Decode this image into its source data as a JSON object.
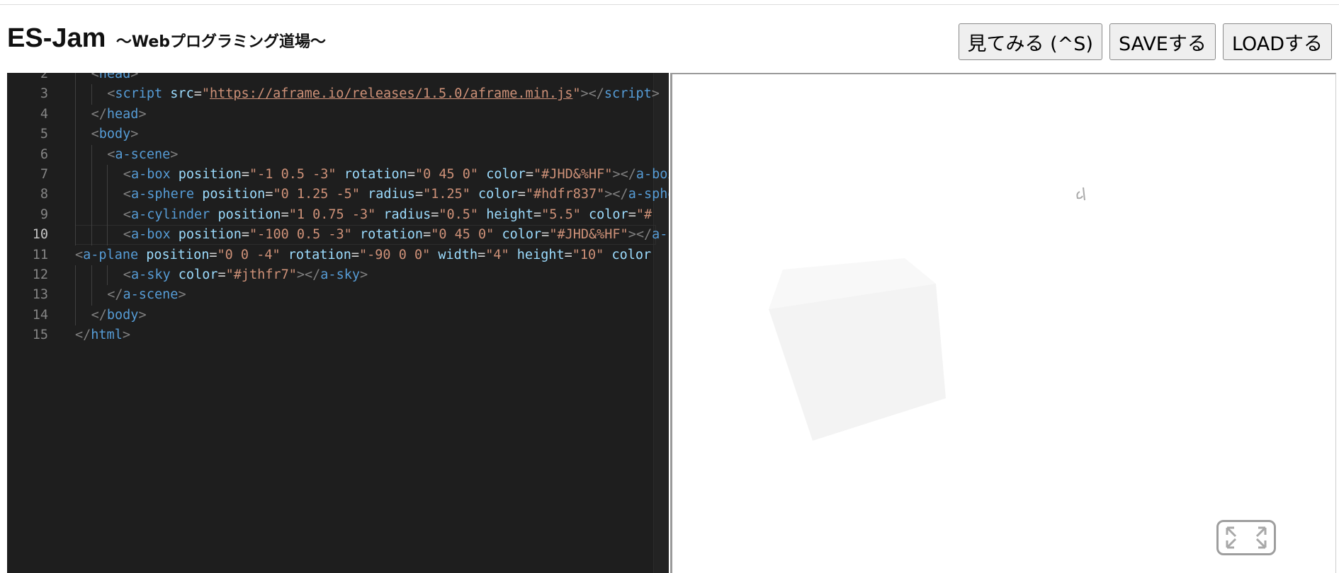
{
  "header": {
    "title": "ES-Jam",
    "subtitle": "～Webプログラミング道場～",
    "buttons": {
      "preview": "見てみる (^S)",
      "save": "SAVEする",
      "load": "LOADする"
    }
  },
  "editor": {
    "active_line": 10,
    "lines": [
      {
        "n": "2",
        "indent": 1,
        "tokens": [
          [
            "b",
            "<"
          ],
          [
            "t",
            "head"
          ],
          [
            "b",
            ">"
          ]
        ]
      },
      {
        "n": "3",
        "indent": 2,
        "tokens": [
          [
            "b",
            "<"
          ],
          [
            "t",
            "script"
          ],
          [
            "p",
            " "
          ],
          [
            "a",
            "src"
          ],
          [
            "p",
            "="
          ],
          [
            "s",
            "\""
          ],
          [
            "u",
            "https://aframe.io/releases/1.5.0/aframe.min.js"
          ],
          [
            "s",
            "\""
          ],
          [
            "b",
            "></"
          ],
          [
            "t",
            "script"
          ],
          [
            "b",
            ">"
          ]
        ]
      },
      {
        "n": "4",
        "indent": 1,
        "tokens": [
          [
            "b",
            "</"
          ],
          [
            "t",
            "head"
          ],
          [
            "b",
            ">"
          ]
        ]
      },
      {
        "n": "5",
        "indent": 1,
        "tokens": [
          [
            "b",
            "<"
          ],
          [
            "t",
            "body"
          ],
          [
            "b",
            ">"
          ]
        ]
      },
      {
        "n": "6",
        "indent": 2,
        "tokens": [
          [
            "b",
            "<"
          ],
          [
            "t",
            "a-scene"
          ],
          [
            "b",
            ">"
          ]
        ]
      },
      {
        "n": "7",
        "indent": 3,
        "tokens": [
          [
            "b",
            "<"
          ],
          [
            "t",
            "a-box"
          ],
          [
            "p",
            " "
          ],
          [
            "a",
            "position"
          ],
          [
            "p",
            "="
          ],
          [
            "s",
            "\"-1 0.5 -3\""
          ],
          [
            "p",
            " "
          ],
          [
            "a",
            "rotation"
          ],
          [
            "p",
            "="
          ],
          [
            "s",
            "\"0 45 0\""
          ],
          [
            "p",
            " "
          ],
          [
            "a",
            "color"
          ],
          [
            "p",
            "="
          ],
          [
            "s",
            "\"#JHD&%HF\""
          ],
          [
            "b",
            "></"
          ],
          [
            "t",
            "a-box"
          ],
          [
            "b",
            ">"
          ]
        ]
      },
      {
        "n": "8",
        "indent": 3,
        "tokens": [
          [
            "b",
            "<"
          ],
          [
            "t",
            "a-sphere"
          ],
          [
            "p",
            " "
          ],
          [
            "a",
            "position"
          ],
          [
            "p",
            "="
          ],
          [
            "s",
            "\"0 1.25 -5\""
          ],
          [
            "p",
            " "
          ],
          [
            "a",
            "radius"
          ],
          [
            "p",
            "="
          ],
          [
            "s",
            "\"1.25\""
          ],
          [
            "p",
            " "
          ],
          [
            "a",
            "color"
          ],
          [
            "p",
            "="
          ],
          [
            "s",
            "\"#hdfr837\""
          ],
          [
            "b",
            "></"
          ],
          [
            "t",
            "a-sphere"
          ],
          [
            "b",
            ">"
          ]
        ]
      },
      {
        "n": "9",
        "indent": 3,
        "tokens": [
          [
            "b",
            "<"
          ],
          [
            "t",
            "a-cylinder"
          ],
          [
            "p",
            " "
          ],
          [
            "a",
            "position"
          ],
          [
            "p",
            "="
          ],
          [
            "s",
            "\"1 0.75 -3\""
          ],
          [
            "p",
            " "
          ],
          [
            "a",
            "radius"
          ],
          [
            "p",
            "="
          ],
          [
            "s",
            "\"0.5\""
          ],
          [
            "p",
            " "
          ],
          [
            "a",
            "height"
          ],
          [
            "p",
            "="
          ],
          [
            "s",
            "\"5.5\""
          ],
          [
            "p",
            " "
          ],
          [
            "a",
            "color"
          ],
          [
            "p",
            "="
          ],
          [
            "s",
            "\"#"
          ]
        ]
      },
      {
        "n": "10",
        "indent": 3,
        "tokens": [
          [
            "b",
            "<"
          ],
          [
            "t",
            "a-box"
          ],
          [
            "p",
            " "
          ],
          [
            "a",
            "position"
          ],
          [
            "p",
            "="
          ],
          [
            "s",
            "\"-100 0.5 -3\""
          ],
          [
            "p",
            " "
          ],
          [
            "a",
            "rotation"
          ],
          [
            "p",
            "="
          ],
          [
            "s",
            "\"0 45 0\""
          ],
          [
            "p",
            " "
          ],
          [
            "a",
            "color"
          ],
          [
            "p",
            "="
          ],
          [
            "s",
            "\"#JHD&%HF\""
          ],
          [
            "b",
            "></"
          ],
          [
            "t",
            "a-box"
          ],
          [
            "b",
            ">"
          ]
        ]
      },
      {
        "n": "11",
        "indent": 0,
        "tokens": [
          [
            "b",
            "<"
          ],
          [
            "t",
            "a-plane"
          ],
          [
            "p",
            " "
          ],
          [
            "a",
            "position"
          ],
          [
            "p",
            "="
          ],
          [
            "s",
            "\"0 0 -4\""
          ],
          [
            "p",
            " "
          ],
          [
            "a",
            "rotation"
          ],
          [
            "p",
            "="
          ],
          [
            "s",
            "\"-90 0 0\""
          ],
          [
            "p",
            " "
          ],
          [
            "a",
            "width"
          ],
          [
            "p",
            "="
          ],
          [
            "s",
            "\"4\""
          ],
          [
            "p",
            " "
          ],
          [
            "a",
            "height"
          ],
          [
            "p",
            "="
          ],
          [
            "s",
            "\"10\""
          ],
          [
            "p",
            " "
          ],
          [
            "a",
            "color"
          ]
        ]
      },
      {
        "n": "12",
        "indent": 3,
        "tokens": [
          [
            "b",
            "<"
          ],
          [
            "t",
            "a-sky"
          ],
          [
            "p",
            " "
          ],
          [
            "a",
            "color"
          ],
          [
            "p",
            "="
          ],
          [
            "s",
            "\"#jthfr7\""
          ],
          [
            "b",
            "></"
          ],
          [
            "t",
            "a-sky"
          ],
          [
            "b",
            ">"
          ]
        ]
      },
      {
        "n": "13",
        "indent": 2,
        "tokens": [
          [
            "b",
            "</"
          ],
          [
            "t",
            "a-scene"
          ],
          [
            "b",
            ">"
          ]
        ]
      },
      {
        "n": "14",
        "indent": 1,
        "tokens": [
          [
            "b",
            "</"
          ],
          [
            "t",
            "body"
          ],
          [
            "b",
            ">"
          ]
        ]
      },
      {
        "n": "15",
        "indent": 0,
        "tokens": [
          [
            "b",
            "</"
          ],
          [
            "t",
            "html"
          ],
          [
            "b",
            ">"
          ]
        ]
      }
    ]
  },
  "preview": {
    "scene_objects": [
      "box",
      "small-sphere"
    ],
    "vr_button_icon": "fullscreen-icon"
  },
  "colors": {
    "editor_bg": "#1e1e1e",
    "tag": "#569cd6",
    "attr": "#9cdcfe",
    "string": "#ce9178",
    "bracket": "#808080"
  }
}
